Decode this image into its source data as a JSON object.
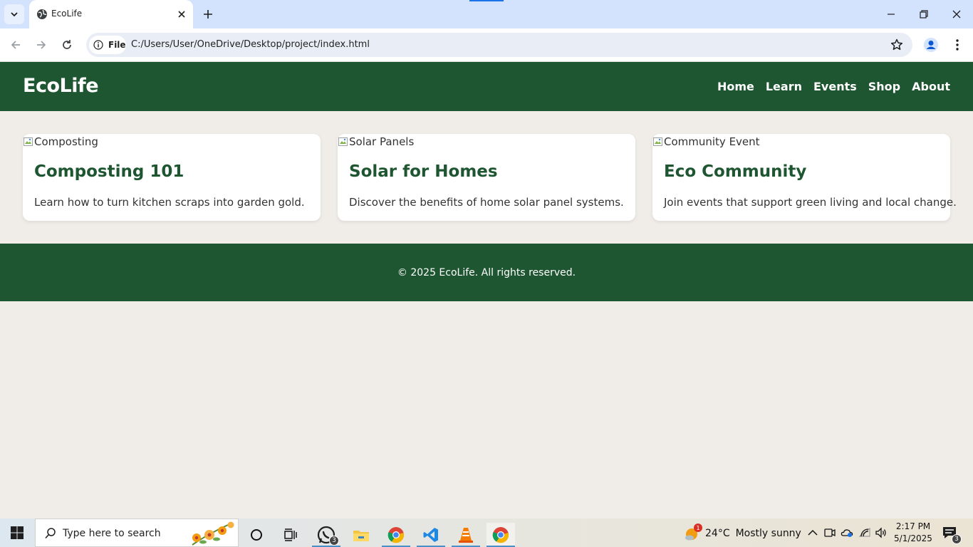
{
  "browser": {
    "tab_title": "EcoLife",
    "file_chip": "File",
    "url": "C:/Users/User/OneDrive/Desktop/project/index.html"
  },
  "site": {
    "logo": "EcoLife",
    "nav": [
      "Home",
      "Learn",
      "Events",
      "Shop",
      "About"
    ],
    "cards": [
      {
        "img_alt": "Composting",
        "title": "Composting 101",
        "desc": "Learn how to turn kitchen scraps into garden gold."
      },
      {
        "img_alt": "Solar Panels",
        "title": "Solar for Homes",
        "desc": "Discover the benefits of home solar panel systems."
      },
      {
        "img_alt": "Community Event",
        "title": "Eco Community",
        "desc": "Join events that support green living and local change."
      }
    ],
    "footer": "© 2025 EcoLife. All rights reserved."
  },
  "taskbar": {
    "search_placeholder": "Type here to search",
    "whatsapp_badge": "3",
    "weather_badge": "1",
    "temperature": "24°C",
    "weather_text": "Mostly sunny",
    "time": "2:17 PM",
    "date": "5/1/2025",
    "notification_count": "3"
  },
  "colors": {
    "brand_green": "#1e5631",
    "page_bg": "#f0ede8",
    "tabstrip": "#d3e3fd"
  }
}
